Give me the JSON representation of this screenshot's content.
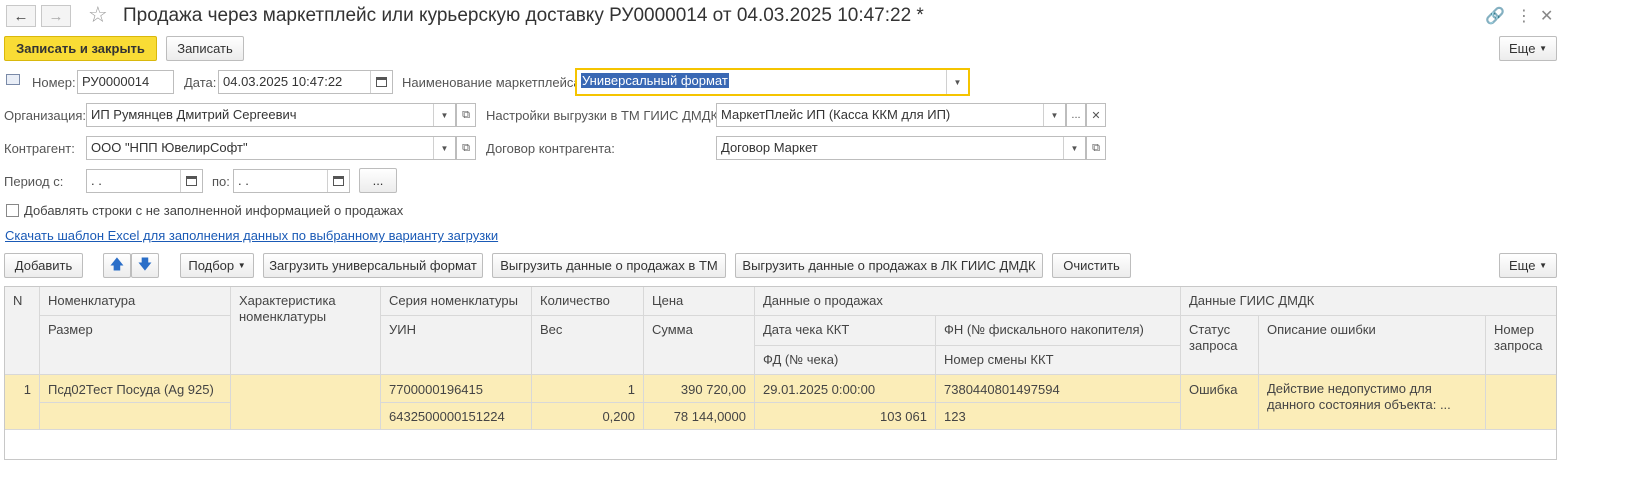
{
  "window": {
    "title": "Продажа через маркетплейс или курьерскую доставку РУ0000014 от 04.03.2025 10:47:22 *"
  },
  "toolbar": {
    "save_close": "Записать и закрыть",
    "save": "Записать",
    "more": "Еще"
  },
  "form": {
    "number_label": "Номер:",
    "number_value": "РУ0000014",
    "date_label": "Дата:",
    "date_value": "04.03.2025 10:47:22",
    "marketplace_label": "Наименование маркетплейса:",
    "marketplace_value": "Универсальный формат",
    "org_label": "Организация:",
    "org_value": "ИП Румянцев Дмитрий Сергеевич",
    "export_settings_label": "Настройки выгрузки в ТМ ГИИС ДМДК:",
    "export_settings_value": "МаркетПлейс ИП (Касса ККМ для ИП)",
    "counterparty_label": "Контрагент:",
    "counterparty_value": "ООО \"НПП ЮвелирСофт\"",
    "contract_label": "Договор контрагента:",
    "contract_value": "Договор Маркет",
    "period_from_label": "Период с:",
    "period_from_value": " .  .",
    "period_to_label": "по:",
    "period_to_value": " .  .",
    "period_btn": "...",
    "add_rows_checkbox": "Добавлять строки с не заполненной информацией о продажах",
    "add_rows_checked": false,
    "template_link": "Скачать шаблон Excel для заполнения данных по выбранному варианту загрузки"
  },
  "table_toolbar": {
    "add": "Добавить",
    "pick": "Подбор",
    "load_universal": "Загрузить универсальный формат",
    "export_tm": "Выгрузить данные о продажах в ТМ",
    "export_lk": "Выгрузить данные о продажах в ЛК ГИИС ДМДК",
    "clear": "Очистить",
    "more": "Еще"
  },
  "table": {
    "headers": {
      "n": "N",
      "nomenclature": "Номенклатура",
      "size": "Размер",
      "characteristic": "Характеристика номенклатуры",
      "series": "Серия номенклатуры",
      "uin": "УИН",
      "quantity": "Количество",
      "weight": "Вес",
      "price": "Цена",
      "sum": "Сумма",
      "sales_data": "Данные о продажах",
      "check_date": "Дата чека ККТ",
      "fd": "ФД (№ чека)",
      "fn": "ФН (№ фискального накопителя)",
      "shift": "Номер смены ККТ",
      "giis_data": "Данные ГИИС ДМДК",
      "request_status": "Статус запроса",
      "error_desc": "Описание ошибки",
      "request_number": "Номер запроса"
    },
    "rows": [
      {
        "n": "1",
        "nomenclature": "Псд02Тест Посуда (Ag 925)",
        "size": "",
        "characteristic": "",
        "series": "7700000196415",
        "uin": "6432500000151224",
        "quantity": "1",
        "weight": "0,200",
        "price": "390 720,00",
        "sum": "78 144,0000",
        "check_date": "29.01.2025 0:00:00",
        "fd": "103 061",
        "fn": "7380440801497594",
        "shift": "123",
        "status": "Ошибка",
        "error": "Действие недопустимо для данного состояния объекта: ...",
        "request_number": ""
      }
    ]
  }
}
